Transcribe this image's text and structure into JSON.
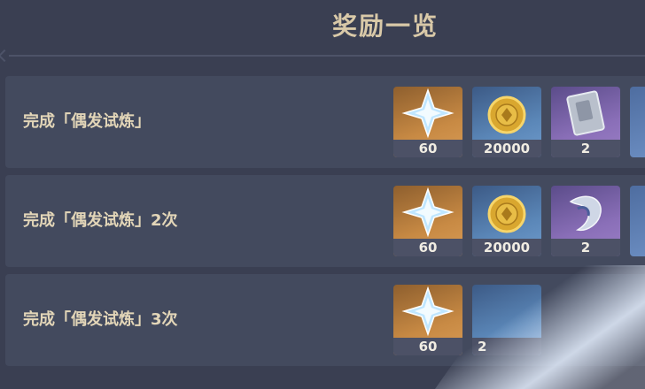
{
  "header": {
    "title": "奖励一览"
  },
  "rows": [
    {
      "label": "完成「偶发试炼」",
      "rewards": [
        {
          "icon": "primogem-icon",
          "count": "60"
        },
        {
          "icon": "mora-coin-icon",
          "count": "20000"
        },
        {
          "icon": "talent-book-icon",
          "count": "2"
        }
      ]
    },
    {
      "label": "完成「偶发试炼」2次",
      "rewards": [
        {
          "icon": "primogem-icon",
          "count": "60"
        },
        {
          "icon": "mora-coin-icon",
          "count": "20000"
        },
        {
          "icon": "weapon-material-icon",
          "count": "2"
        }
      ]
    },
    {
      "label": "完成「偶发试炼」3次",
      "rewards": [
        {
          "icon": "primogem-icon",
          "count": "60"
        },
        {
          "icon": "reward-icon",
          "count": "2"
        }
      ]
    }
  ]
}
